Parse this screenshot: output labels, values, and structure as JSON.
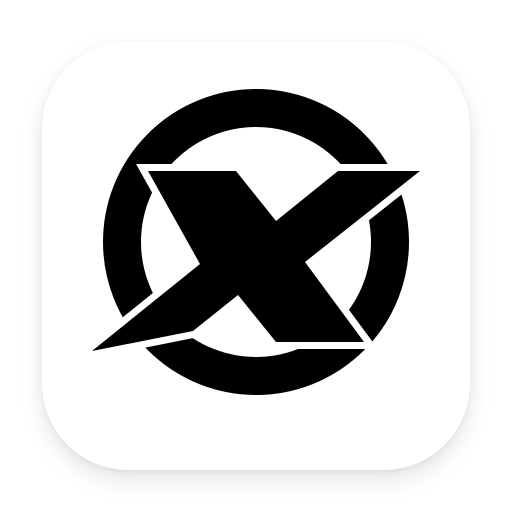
{
  "icon": {
    "name": "x-circle-logo-icon",
    "tile_color": "#ffffff",
    "glyph_color": "#000000"
  }
}
